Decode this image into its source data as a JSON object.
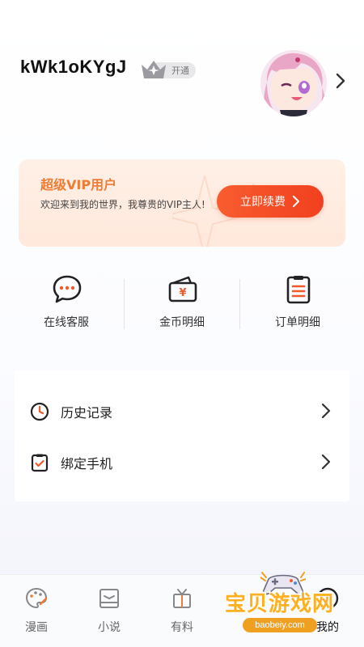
{
  "profile": {
    "username": "kWk1oKYgJ",
    "vip_badge_label": "开通"
  },
  "vip_card": {
    "title": "超级VIP用户",
    "description": "欢迎来到我的世界，我尊贵的VIP主人!",
    "renew_label": "立即续费"
  },
  "quick_links": [
    {
      "label": "在线客服",
      "icon": "chat-bubble-icon"
    },
    {
      "label": "金币明细",
      "icon": "wallet-icon"
    },
    {
      "label": "订单明细",
      "icon": "clipboard-list-icon"
    }
  ],
  "menu": [
    {
      "label": "历史记录",
      "icon": "clock-icon"
    },
    {
      "label": "绑定手机",
      "icon": "clipboard-check-icon"
    }
  ],
  "tabs": [
    {
      "label": "漫画",
      "icon": "palette-icon"
    },
    {
      "label": "小说",
      "icon": "book-icon"
    },
    {
      "label": "有料",
      "icon": "gift-icon"
    },
    {
      "label": "",
      "icon": "game-icon"
    },
    {
      "label": "我的",
      "icon": "profile-icon",
      "active": true
    }
  ],
  "watermark": {
    "text": "宝贝游戏网",
    "url": "baobeiy.com"
  },
  "colors": {
    "accent_orange": "#f07b34",
    "button_red": "#f1401f",
    "vip_card_bg": "#ffe8dc"
  }
}
